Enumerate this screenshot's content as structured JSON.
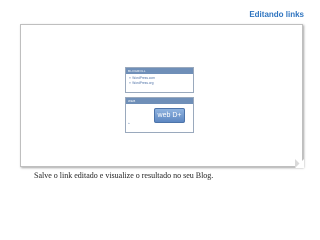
{
  "slide": {
    "title": "Editando links",
    "caption": "Salve o link editado e visualize o resultado no seu Blog."
  },
  "widget_blogroll": {
    "header": "BLOGROLL",
    "links": [
      {
        "bullet": "»",
        "label": "WordPress.com"
      },
      {
        "bullet": "»",
        "label": "WordPress.org"
      }
    ]
  },
  "widget_web": {
    "header": "WEB",
    "button_label": "web D+",
    "marker": "»"
  },
  "colors": {
    "title": "#2e74c0",
    "widget_header": "#6f8fb8",
    "link": "#4a6ea5"
  }
}
